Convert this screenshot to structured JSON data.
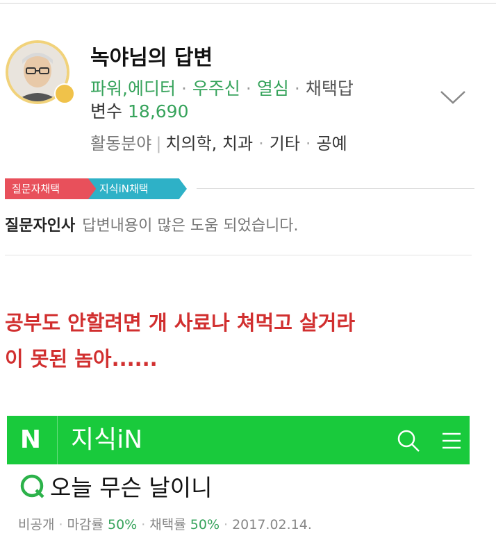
{
  "answer": {
    "author": "녹야님의 답변",
    "roles": [
      "파워,에디터",
      "우주신",
      "열심"
    ],
    "adoption_label": "채택답",
    "adoption_label2": "변수",
    "adoption_count": "18,690",
    "field_label": "활동분야",
    "fields": [
      "치의학, 치과",
      "기타",
      "공예"
    ]
  },
  "tags": {
    "questioner_pick": "질문자채택",
    "jisik_pick": "지식iN채택"
  },
  "greeting": {
    "label": "질문자인사",
    "message": "답변내용이 많은 도움 되었습니다."
  },
  "red_text": {
    "line1": "공부도 안할려면 개 사료나 쳐먹고 살거라",
    "line2": "이 못된 놈아......"
  },
  "navbar": {
    "logo": "N",
    "title": "지식iN",
    "bg_color": "#19ca3c"
  },
  "question": {
    "title": "오늘 무슨 날이니",
    "visibility": "비공개",
    "deadline_label": "마감률",
    "deadline_value": "50%",
    "adopt_label": "채택률",
    "adopt_value": "50%",
    "date": "2017.02.14."
  }
}
